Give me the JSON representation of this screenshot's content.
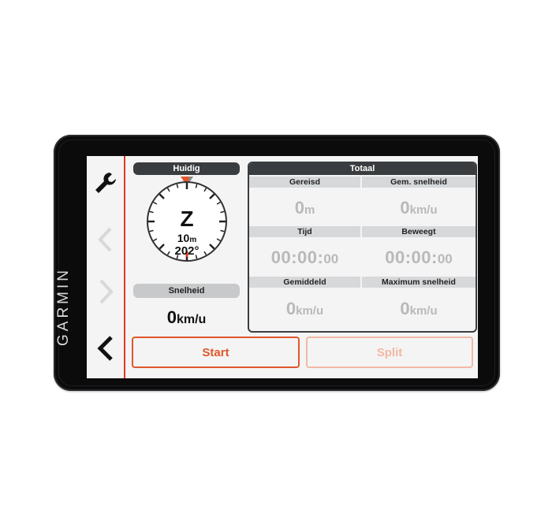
{
  "device": {
    "brand": "GARMIN"
  },
  "sidebar": {
    "items": [
      {
        "name": "settings",
        "icon": "wrench-icon",
        "enabled": true
      },
      {
        "name": "page-back",
        "icon": "chevron-left-icon",
        "enabled": false
      },
      {
        "name": "page-forward",
        "icon": "chevron-right-icon",
        "enabled": false
      },
      {
        "name": "back",
        "icon": "chevron-left-bold-icon",
        "enabled": true
      }
    ]
  },
  "current": {
    "header": "Huidig",
    "heading_letter": "Z",
    "accuracy": "10",
    "accuracy_unit": "m",
    "bearing": "202°",
    "speed_label": "Snelheid",
    "speed_value": "0",
    "speed_unit": "km/u"
  },
  "total": {
    "header": "Totaal",
    "cells": [
      {
        "label": "Gereisd",
        "value": "0",
        "unit": "m"
      },
      {
        "label": "Gem. snelheid",
        "value": "0",
        "unit": "km/u"
      },
      {
        "label": "Tijd",
        "value": "00:00:",
        "value_small": "00"
      },
      {
        "label": "Beweegt",
        "value": "00:00:",
        "value_small": "00"
      },
      {
        "label": "Gemiddeld",
        "value": "0",
        "unit": "km/u"
      },
      {
        "label": "Maximum snelheid",
        "value": "0",
        "unit": "km/u"
      }
    ]
  },
  "buttons": {
    "start": "Start",
    "split": "Split"
  },
  "colors": {
    "accent": "#e53a1d",
    "button_orange": "#e0572a",
    "header_dark": "#3a3d40",
    "label_grey": "#d6d8da"
  }
}
